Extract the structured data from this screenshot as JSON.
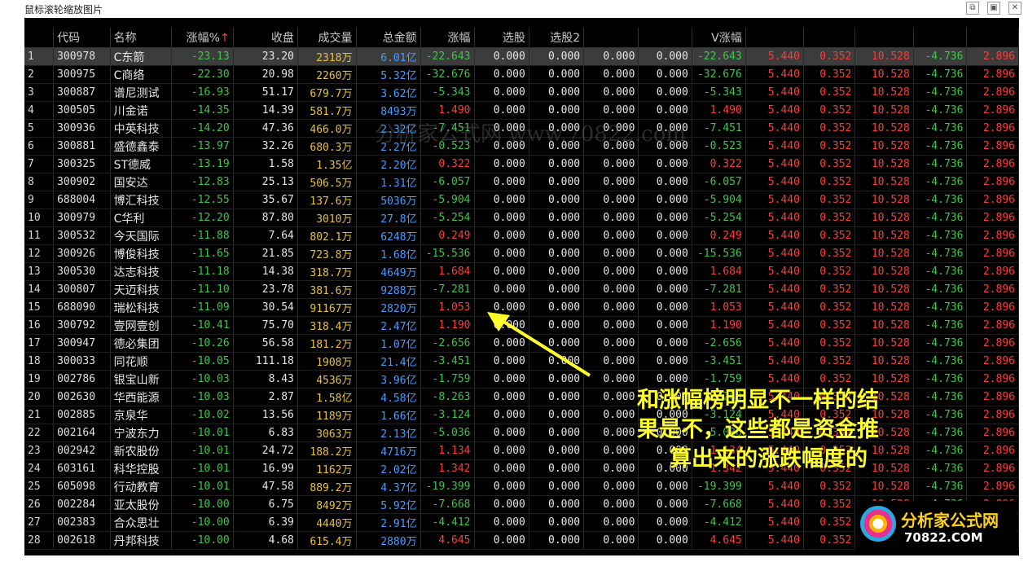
{
  "window": {
    "title": "鼠标滚轮缩放图片",
    "buttons": [
      "⧉",
      "▣",
      "✕"
    ]
  },
  "columns": [
    "",
    "代码",
    "名称",
    "涨幅%",
    "收盘",
    "成交量",
    "总金额",
    "涨幅",
    "选股",
    "选股2",
    "",
    "",
    "V涨幅",
    "",
    "",
    "",
    "",
    ""
  ],
  "sort_indicator": "↑",
  "rows": [
    [
      "1",
      "300978",
      "C东箭",
      "-23.13",
      "23.20",
      "2318万",
      "6.01亿",
      "-22.643",
      "0.000",
      "0.000",
      "0.000",
      "0.000",
      "-22.643",
      "5.440",
      "0.352",
      "10.528",
      "-4.736",
      "2.896"
    ],
    [
      "2",
      "300975",
      "C商络",
      "-22.30",
      "20.98",
      "2260万",
      "5.32亿",
      "-32.676",
      "0.000",
      "0.000",
      "0.000",
      "0.000",
      "-32.676",
      "5.440",
      "0.352",
      "10.528",
      "-4.736",
      "2.896"
    ],
    [
      "3",
      "300887",
      "谱尼测试",
      "-16.93",
      "51.17",
      "679.7万",
      "3.62亿",
      "-5.343",
      "0.000",
      "0.000",
      "0.000",
      "0.000",
      "-5.343",
      "5.440",
      "0.352",
      "10.528",
      "-4.736",
      "2.896"
    ],
    [
      "4",
      "300505",
      "川金诺",
      "-14.35",
      "14.39",
      "581.7万",
      "8493万",
      "1.490",
      "0.000",
      "0.000",
      "0.000",
      "0.000",
      "1.490",
      "5.440",
      "0.352",
      "10.528",
      "-4.736",
      "2.896"
    ],
    [
      "5",
      "300936",
      "中英科技",
      "-14.20",
      "47.36",
      "466.0万",
      "2.32亿",
      "-7.451",
      "0.000",
      "0.000",
      "0.000",
      "0.000",
      "-7.451",
      "5.440",
      "0.352",
      "10.528",
      "-4.736",
      "2.896"
    ],
    [
      "6",
      "300881",
      "盛德鑫泰",
      "-13.97",
      "32.26",
      "680.3万",
      "2.27亿",
      "-0.523",
      "0.000",
      "0.000",
      "0.000",
      "0.000",
      "-0.523",
      "5.440",
      "0.352",
      "10.528",
      "-4.736",
      "2.896"
    ],
    [
      "7",
      "300325",
      "ST德威",
      "-13.19",
      "1.58",
      "1.35亿",
      "2.20亿",
      "0.322",
      "0.000",
      "0.000",
      "0.000",
      "0.000",
      "0.322",
      "5.440",
      "0.352",
      "10.528",
      "-4.736",
      "2.896"
    ],
    [
      "8",
      "300902",
      "国安达",
      "-12.83",
      "25.13",
      "506.5万",
      "1.31亿",
      "-6.057",
      "0.000",
      "0.000",
      "0.000",
      "0.000",
      "-6.057",
      "5.440",
      "0.352",
      "10.528",
      "-4.736",
      "2.896"
    ],
    [
      "9",
      "688004",
      "博汇科技",
      "-12.55",
      "35.67",
      "137.6万",
      "5036万",
      "-5.904",
      "0.000",
      "0.000",
      "0.000",
      "0.000",
      "-5.904",
      "5.440",
      "0.352",
      "10.528",
      "-4.736",
      "2.896"
    ],
    [
      "10",
      "300979",
      "C华利",
      "-12.20",
      "87.80",
      "3010万",
      "27.8亿",
      "-5.254",
      "0.000",
      "0.000",
      "0.000",
      "0.000",
      "-5.254",
      "5.440",
      "0.352",
      "10.528",
      "-4.736",
      "2.896"
    ],
    [
      "11",
      "300532",
      "今天国际",
      "-11.88",
      "7.64",
      "802.1万",
      "6248万",
      "0.249",
      "0.000",
      "0.000",
      "0.000",
      "0.000",
      "0.249",
      "5.440",
      "0.352",
      "10.528",
      "-4.736",
      "2.896"
    ],
    [
      "12",
      "300926",
      "博俊科技",
      "-11.65",
      "21.85",
      "723.8万",
      "1.68亿",
      "-15.536",
      "0.000",
      "0.000",
      "0.000",
      "0.000",
      "-15.536",
      "5.440",
      "0.352",
      "10.528",
      "-4.736",
      "2.896"
    ],
    [
      "13",
      "300530",
      "达志科技",
      "-11.18",
      "14.38",
      "318.7万",
      "4649万",
      "1.684",
      "0.000",
      "0.000",
      "0.000",
      "0.000",
      "1.684",
      "5.440",
      "0.352",
      "10.528",
      "-4.736",
      "2.896"
    ],
    [
      "14",
      "300807",
      "天迈科技",
      "-11.10",
      "23.78",
      "381.6万",
      "9288万",
      "-7.281",
      "0.000",
      "0.000",
      "0.000",
      "0.000",
      "-7.281",
      "5.440",
      "0.352",
      "10.528",
      "-4.736",
      "2.896"
    ],
    [
      "15",
      "688090",
      "瑞松科技",
      "-11.09",
      "30.54",
      "91167万",
      "2820万",
      "1.053",
      "0.000",
      "0.000",
      "0.000",
      "0.000",
      "1.053",
      "5.440",
      "0.352",
      "10.528",
      "-4.736",
      "2.896"
    ],
    [
      "16",
      "300792",
      "壹网壹创",
      "-10.41",
      "75.70",
      "318.4万",
      "2.47亿",
      "1.190",
      "0.000",
      "0.000",
      "0.000",
      "0.000",
      "1.190",
      "5.440",
      "0.352",
      "10.528",
      "-4.736",
      "2.896"
    ],
    [
      "17",
      "300947",
      "德必集团",
      "-10.26",
      "56.58",
      "181.2万",
      "1.07亿",
      "-2.656",
      "0.000",
      "0.000",
      "0.000",
      "0.000",
      "-2.656",
      "5.440",
      "0.352",
      "10.528",
      "-4.736",
      "2.896"
    ],
    [
      "18",
      "300033",
      "同花顺",
      "-10.05",
      "111.18",
      "1908万",
      "21.4亿",
      "-3.451",
      "0.000",
      "0.000",
      "0.000",
      "0.000",
      "-3.451",
      "5.440",
      "0.352",
      "10.528",
      "-4.736",
      "2.896"
    ],
    [
      "19",
      "002786",
      "银宝山新",
      "-10.03",
      "8.43",
      "4536万",
      "3.96亿",
      "-1.759",
      "0.000",
      "0.000",
      "0.000",
      "0.000",
      "-1.759",
      "5.440",
      "0.352",
      "10.528",
      "-4.736",
      "2.896"
    ],
    [
      "20",
      "002630",
      "华西能源",
      "-10.03",
      "2.87",
      "1.58亿",
      "4.58亿",
      "-8.263",
      "0.000",
      "0.000",
      "0.000",
      "0.000",
      "-8.263",
      "5.440",
      "0.352",
      "10.528",
      "-4.736",
      "2.896"
    ],
    [
      "21",
      "002885",
      "京泉华",
      "-10.02",
      "13.56",
      "1189万",
      "1.66亿",
      "-3.124",
      "0.000",
      "0.000",
      "0.000",
      "0.000",
      "-3.124",
      "5.440",
      "0.352",
      "10.528",
      "-4.736",
      "2.896"
    ],
    [
      "22",
      "002164",
      "宁波东力",
      "-10.01",
      "6.83",
      "3063万",
      "2.13亿",
      "-5.036",
      "0.000",
      "0.000",
      "0.000",
      "0.000",
      "-5.036",
      "5.440",
      "0.352",
      "10.528",
      "-4.736",
      "2.896"
    ],
    [
      "23",
      "002942",
      "新农股份",
      "-10.01",
      "24.72",
      "188.2万",
      "4716万",
      "1.134",
      "0.000",
      "0.000",
      "0.000",
      "0.000",
      "1.134",
      "5.440",
      "0.352",
      "10.528",
      "-4.736",
      "2.896"
    ],
    [
      "24",
      "603161",
      "科华控股",
      "-10.01",
      "16.99",
      "1162万",
      "2.02亿",
      "1.342",
      "0.000",
      "0.000",
      "0.000",
      "0.000",
      "1.342",
      "5.440",
      "0.352",
      "10.528",
      "-4.736",
      "2.896"
    ],
    [
      "25",
      "605098",
      "行动教育",
      "-10.01",
      "47.58",
      "889.2万",
      "4.37亿",
      "-19.399",
      "0.000",
      "0.000",
      "0.000",
      "0.000",
      "-19.399",
      "5.440",
      "0.352",
      "10.528",
      "-4.736",
      "2.896"
    ],
    [
      "26",
      "002284",
      "亚太股份",
      "-10.00",
      "6.75",
      "8492万",
      "5.92亿",
      "-7.668",
      "0.000",
      "0.000",
      "0.000",
      "0.000",
      "-7.668",
      "5.440",
      "0.352",
      "10.528",
      "-4.736",
      "2.896"
    ],
    [
      "27",
      "002383",
      "合众思壮",
      "-10.00",
      "6.39",
      "4440万",
      "2.91亿",
      "-4.412",
      "0.000",
      "0.000",
      "0.000",
      "0.000",
      "-4.412",
      "5.440",
      "0.352",
      "10.528",
      "-4.736",
      "2.896"
    ],
    [
      "28",
      "002618",
      "丹邦科技",
      "-10.00",
      "4.68",
      "615.4万",
      "2880万",
      "4.645",
      "0.000",
      "0.000",
      "0.000",
      "0.000",
      "4.645",
      "5.440",
      "0.352",
      "10.528",
      "-4.736",
      "2.896"
    ]
  ],
  "annotation": {
    "lines": [
      "和涨幅榜明显不一样的结",
      "果是不，这些都是资金推",
      "算出来的涨跌幅度的"
    ]
  },
  "watermark": "分析家公式网 www.70822.com",
  "logo": {
    "name": "分析家公式网",
    "url": "70822.COM"
  },
  "colors": {
    "background": "#000000",
    "negative": "#3ec64a",
    "positive": "#ff3b3b",
    "volume": "#e8c23a",
    "amount": "#4a9cff",
    "annotation": "#ffff2e"
  }
}
